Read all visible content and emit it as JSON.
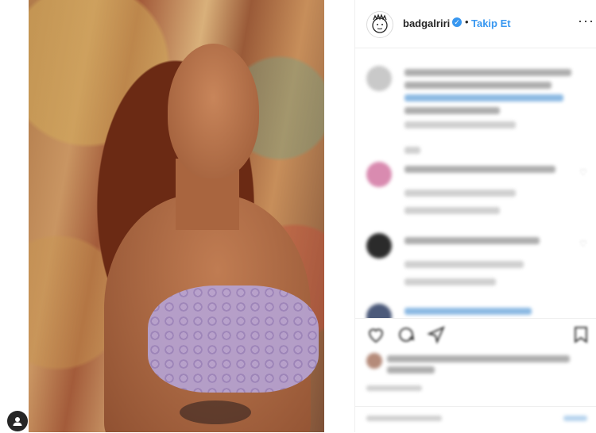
{
  "post": {
    "username": "badgalriri",
    "separator": "•",
    "follow_label": "Takip Et",
    "more_label": "···",
    "verified_glyph": "✓",
    "icons": {
      "avatar": "sketch-face-avatar",
      "verified": "verified-badge-icon",
      "more": "ellipsis-icon",
      "like": "heart-icon",
      "comment": "comment-bubble-icon",
      "share": "paper-plane-icon",
      "save": "bookmark-icon",
      "profile": "user-icon"
    },
    "colors": {
      "accent": "#3897f0",
      "text": "#262626",
      "border": "#efefef"
    }
  }
}
